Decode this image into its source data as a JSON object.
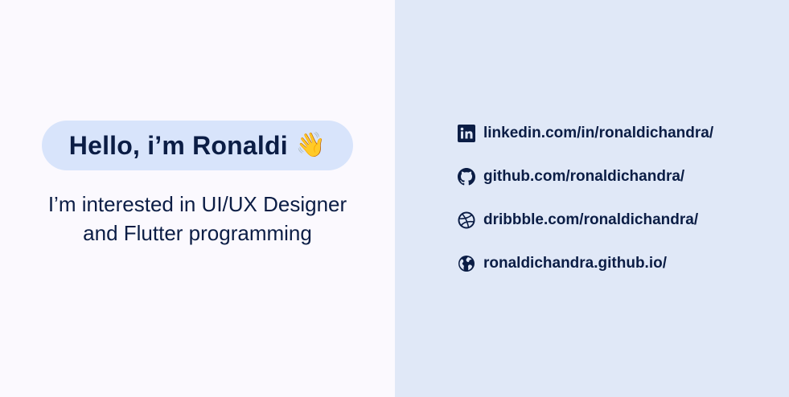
{
  "greeting": {
    "text": "Hello, i’m Ronaldi",
    "emoji": "👋"
  },
  "bio": {
    "text": "I’m interested in UI/UX Designer and Flutter programming"
  },
  "links": [
    {
      "icon": "linkedin-icon",
      "label": "linkedin.com/in/ronaldichandra/"
    },
    {
      "icon": "github-icon",
      "label": "github.com/ronaldichandra/"
    },
    {
      "icon": "dribbble-icon",
      "label": "dribbble.com/ronaldichandra/"
    },
    {
      "icon": "globe-icon",
      "label": "ronaldichandra.github.io/"
    }
  ],
  "colors": {
    "left_bg": "#fbf9fe",
    "right_bg": "#e0e8f7",
    "pill_bg": "#d8e4fb",
    "text": "#0b1d45"
  }
}
